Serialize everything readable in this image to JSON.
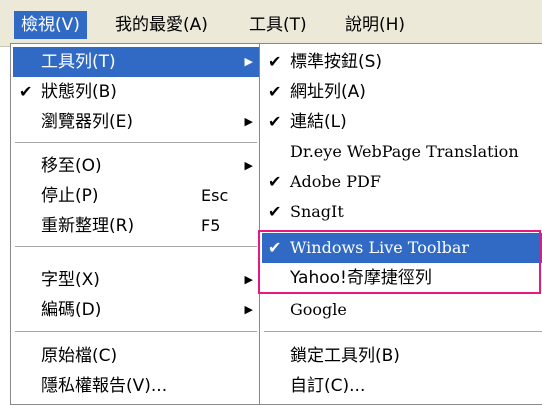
{
  "menubar": {
    "items": [
      {
        "label": "檢視(V)"
      },
      {
        "label": "我的最愛(A)"
      },
      {
        "label": "工具(T)"
      },
      {
        "label": "說明(H)"
      }
    ]
  },
  "view_menu": {
    "items": [
      {
        "label": "工具列(T)",
        "has_submenu": true,
        "highlighted": true
      },
      {
        "label": "狀態列(B)",
        "checked": true
      },
      {
        "label": "瀏覽器列(E)",
        "has_submenu": true
      },
      {
        "label": "移至(O)",
        "has_submenu": true
      },
      {
        "label": "停止(P)",
        "shortcut": "Esc"
      },
      {
        "label": "重新整理(R)",
        "shortcut": "F5"
      },
      {
        "label": "字型(X)",
        "has_submenu": true
      },
      {
        "label": "編碼(D)",
        "has_submenu": true
      },
      {
        "label": "原始檔(C)"
      },
      {
        "label": "隱私權報告(V)..."
      }
    ]
  },
  "toolbars_menu": {
    "items": [
      {
        "label": "標準按鈕(S)",
        "checked": true
      },
      {
        "label": "網址列(A)",
        "checked": true
      },
      {
        "label": "連結(L)",
        "checked": true
      },
      {
        "label": "Dr.eye WebPage Translation"
      },
      {
        "label": "Adobe PDF",
        "checked": true
      },
      {
        "label": "SnagIt",
        "checked": true
      },
      {
        "label": "Windows Live Toolbar",
        "checked": true,
        "highlighted": true
      },
      {
        "label": "Yahoo!奇摩捷徑列"
      },
      {
        "label": "Google"
      },
      {
        "label": "鎖定工具列(B)"
      },
      {
        "label": "自訂(C)..."
      }
    ]
  },
  "glyphs": {
    "check": "✔",
    "arrow": "▶"
  },
  "colors": {
    "highlight": "#316ac5",
    "annotation_box": "#e6197d",
    "menubar_bg": "#ece9d8"
  }
}
